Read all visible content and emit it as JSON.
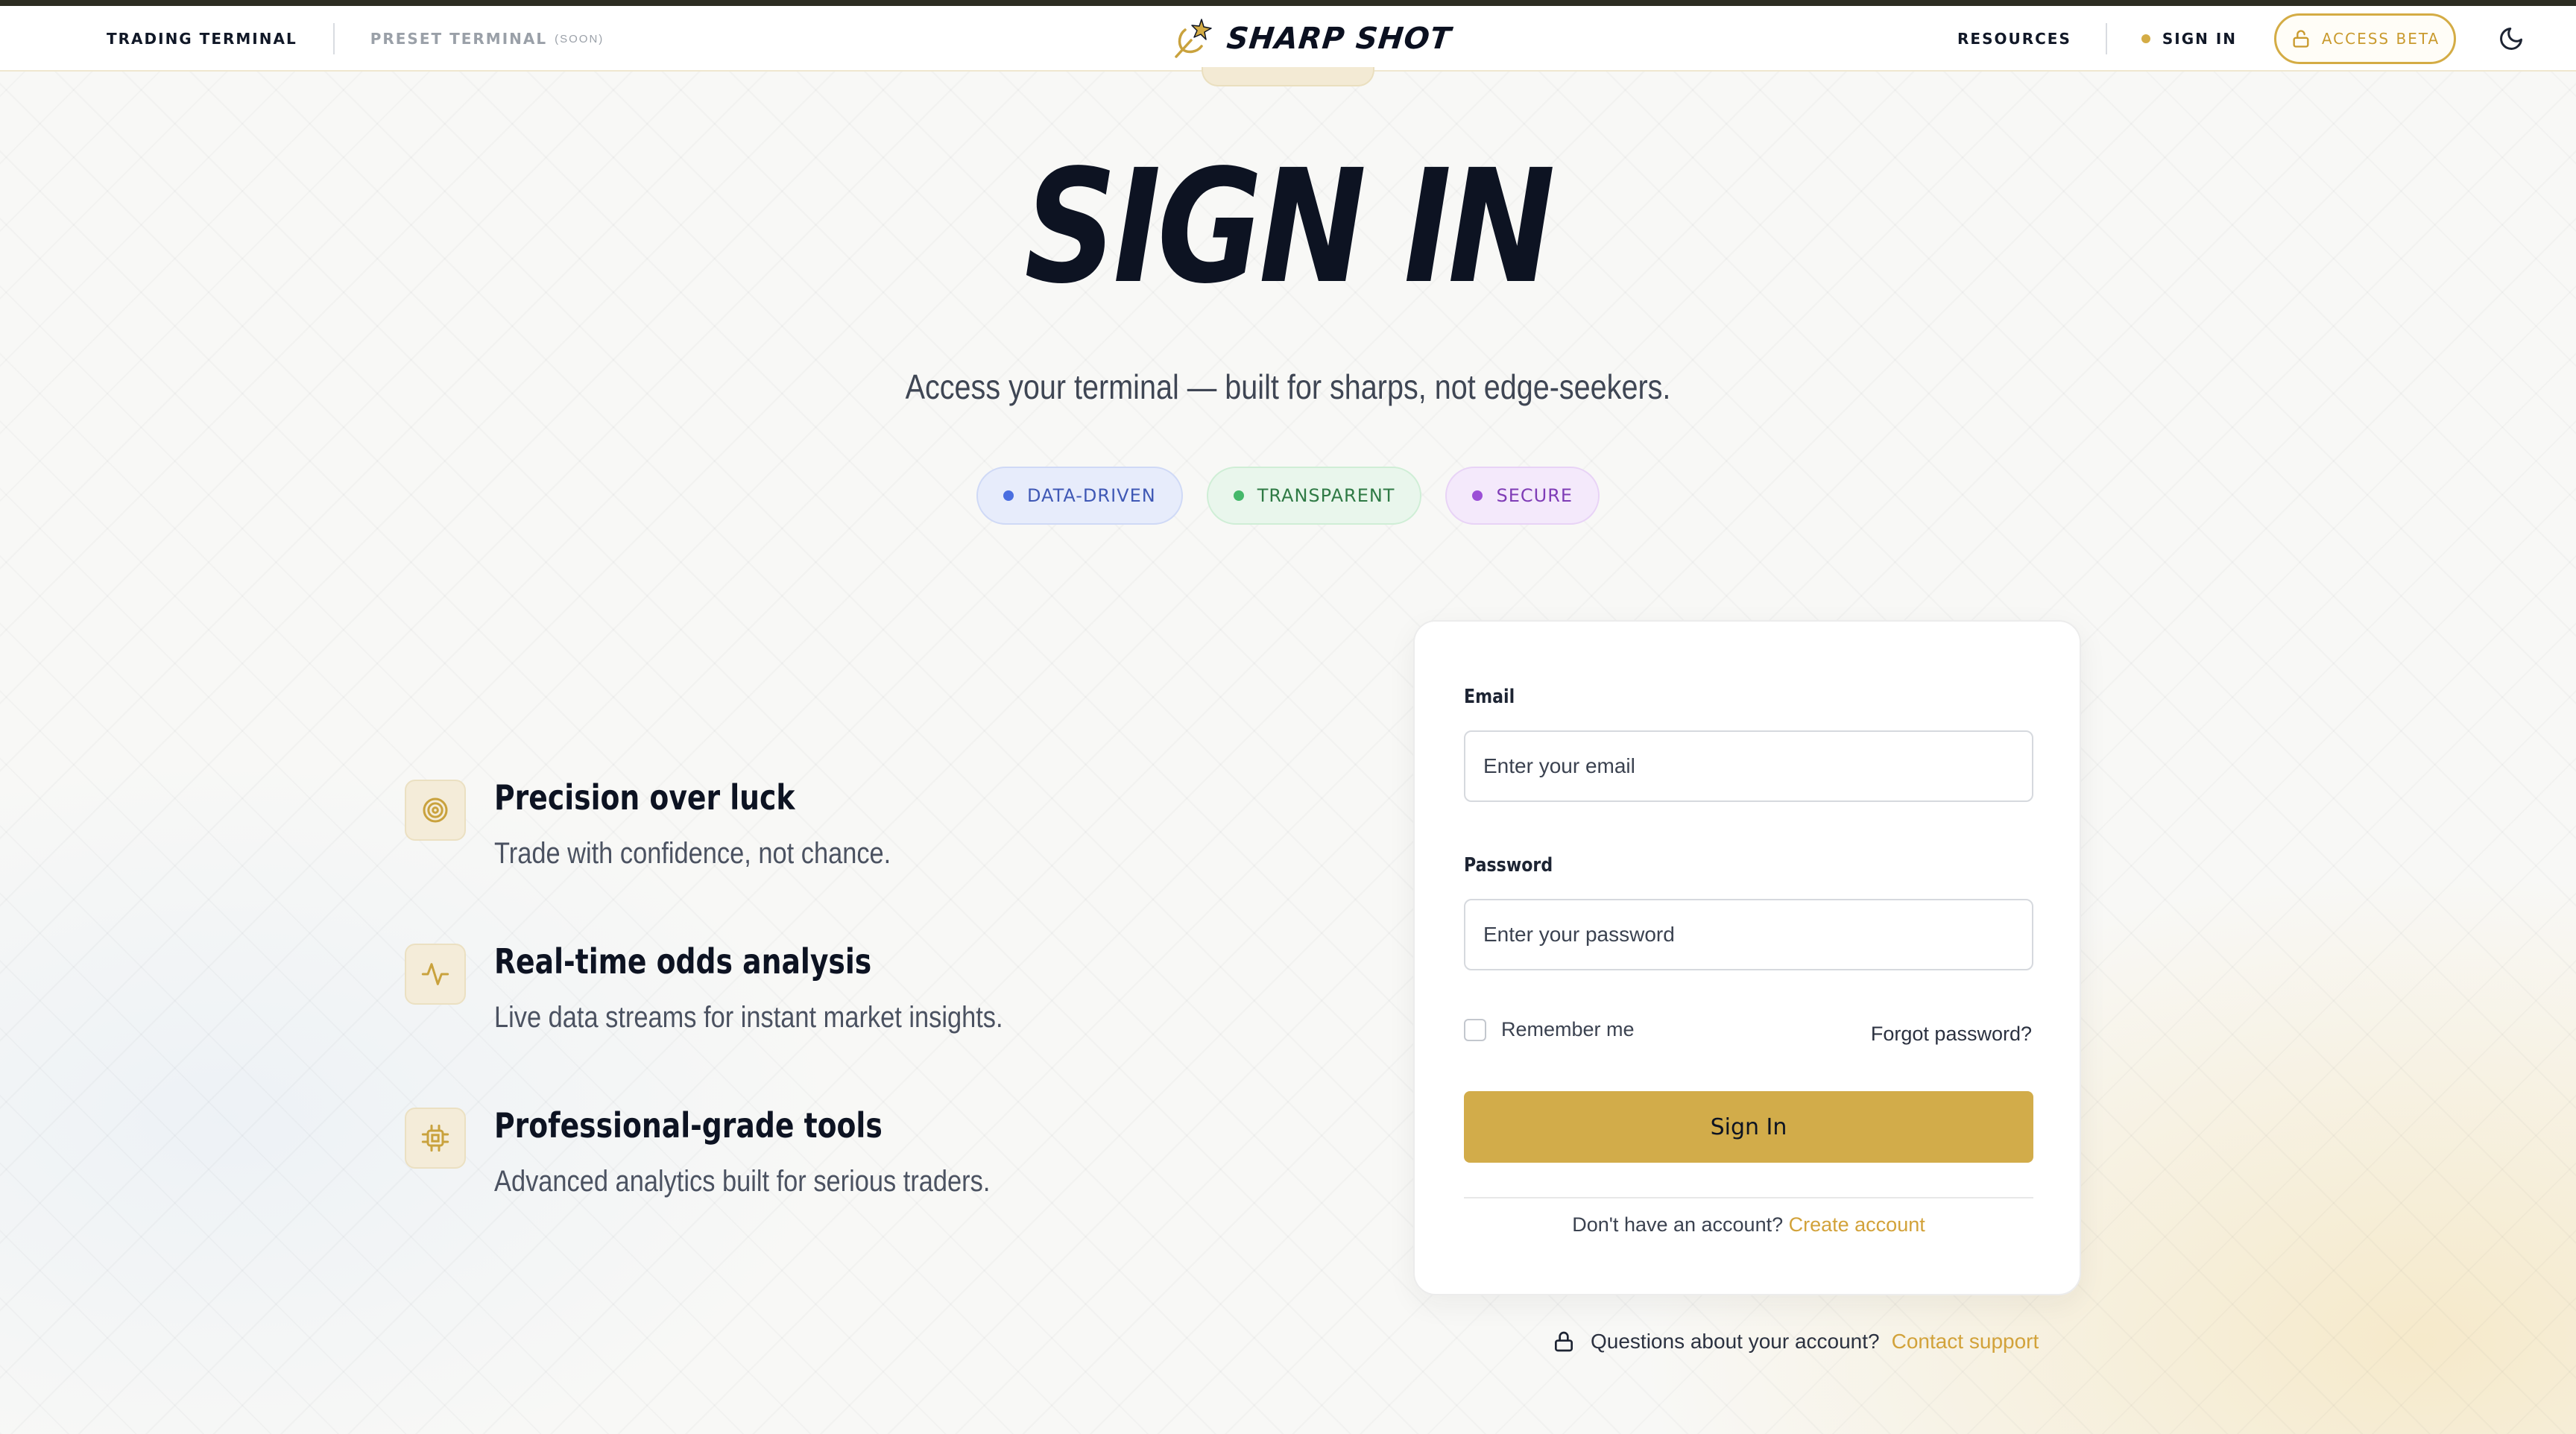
{
  "nav": {
    "trading_terminal": "TRADING TERMINAL",
    "preset_terminal": "PRESET TERMINAL",
    "soon_tag": "(SOON)",
    "brand_name": "SHARP SHOT",
    "resources": "RESOURCES",
    "sign_in": "SIGN IN",
    "access_beta": "ACCESS BETA"
  },
  "hero": {
    "title": "SIGN IN",
    "subtitle": "Access your terminal — built for sharps, not edge-seekers."
  },
  "pills": [
    {
      "label": "DATA-DRIVEN",
      "color": "#4a6ee0"
    },
    {
      "label": "TRANSPARENT",
      "color": "#45b86a"
    },
    {
      "label": "SECURE",
      "color": "#9b4fd6"
    }
  ],
  "features": [
    {
      "icon": "target-icon",
      "title": "Precision over luck",
      "description": "Trade with confidence, not chance."
    },
    {
      "icon": "activity-icon",
      "title": "Real-time odds analysis",
      "description": "Live data streams for instant market insights."
    },
    {
      "icon": "chip-icon",
      "title": "Professional-grade tools",
      "description": "Advanced analytics built for serious traders."
    }
  ],
  "form": {
    "email_label": "Email",
    "email_placeholder": "Enter your email",
    "email_value": "",
    "password_label": "Password",
    "password_placeholder": "Enter your password",
    "password_value": "",
    "remember_me": "Remember me",
    "remember_checked": false,
    "forgot_password": "Forgot password?",
    "submit": "Sign In",
    "no_account": "Don't have an account?",
    "create_account": "Create account"
  },
  "support": {
    "question": "Questions about your account?",
    "link": "Contact support"
  },
  "colors": {
    "accent_gold": "#d2ac4a",
    "ink": "#0d1322"
  }
}
